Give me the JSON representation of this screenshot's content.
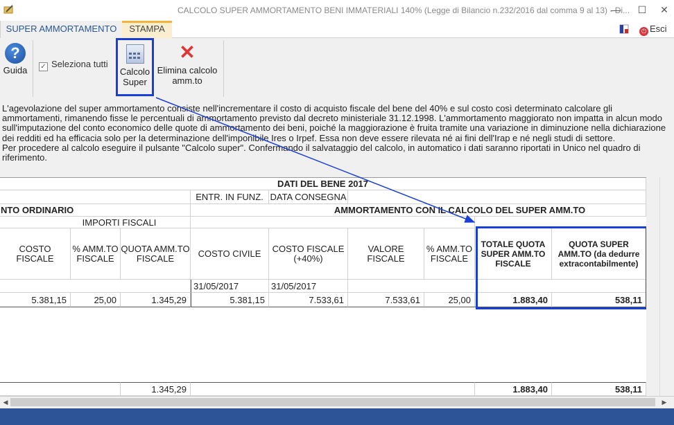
{
  "window": {
    "title": "CALCOLO SUPER AMMORTAMENTO BENI IMMATERIALI 140% (Legge di Bilancio n.232/2016 dal comma 9 al 13) - Di...",
    "minimize": "—",
    "maximize": "☐",
    "close": "✕"
  },
  "tabs": [
    {
      "label": "SUPER AMMORTAMENTO"
    },
    {
      "label": "STAMPA"
    }
  ],
  "exit": {
    "label": "Esci"
  },
  "toolbar": {
    "help_label": "Guida",
    "select_all_label": "Seleziona tutti",
    "select_all_checked": "✓",
    "calc_label_1": "Calcolo",
    "calc_label_2": "Super",
    "delete_label_1": "Elimina calcolo",
    "delete_label_2": "amm.to"
  },
  "description": {
    "para1": "L'agevolazione del super ammortamento consiste nell'incrementare il costo di acquisto fiscale del bene del 40% e sul costo così determinato calcolare gli ammortamenti, rimanendo fisse le percentuali di ammortamento previsto dal decreto ministeriale 31.12.1998. L'ammortamento maggiorato non impatta in alcun modo sull'imputazione del conto economico delle quote di ammortamento dei beni, poiché la maggiorazione è fruita tramite una variazione in diminuzione nella dichiarazione dei redditi ed ha efficacia solo per la determinazione dell'imponibile Ires o Irpef. Essa non deve essere rilevata né ai fini dell'Irap e né negli studi di settore.",
    "para2": "Per procedere al calcolo eseguire il pulsante \"Calcolo super\". Confermando il salvataggio del calcolo, in automatico i dati saranno riportati in Unico nel quadro di riferimento."
  },
  "grid": {
    "group_header": "DATI DEL BENE 2017",
    "entr_header": "ENTR. IN FUNZ.",
    "consegna_header": "DATA CONSEGNA",
    "ordinario_header": "NTO ORDINARIO",
    "super_header": "AMMORTAMENTO CON IL CALCOLO DEL SUPER AMM.TO",
    "importi_header": "IMPORTI FISCALI",
    "columns": [
      "COSTO FISCALE",
      "% AMM.TO FISCALE",
      "QUOTA AMM.TO FISCALE",
      "COSTO CIVILE",
      "COSTO FISCALE (+40%)",
      "VALORE FISCALE",
      "% AMM.TO FISCALE",
      "TOTALE QUOTA SUPER AMM.TO FISCALE",
      "QUOTA SUPER AMM.TO (da dedurre extracontabilmente)"
    ],
    "date_row": {
      "entr": "31/05/2017",
      "consegna": "31/05/2017"
    },
    "data_row": [
      "5.381,15",
      "25,00",
      "1.345,29",
      "5.381,15",
      "7.533,61",
      "7.533,61",
      "25,00",
      "1.883,40",
      "538,11"
    ],
    "totals_row": {
      "quota": "1.345,29",
      "totale_super": "1.883,40",
      "quota_super": "538,11"
    }
  }
}
